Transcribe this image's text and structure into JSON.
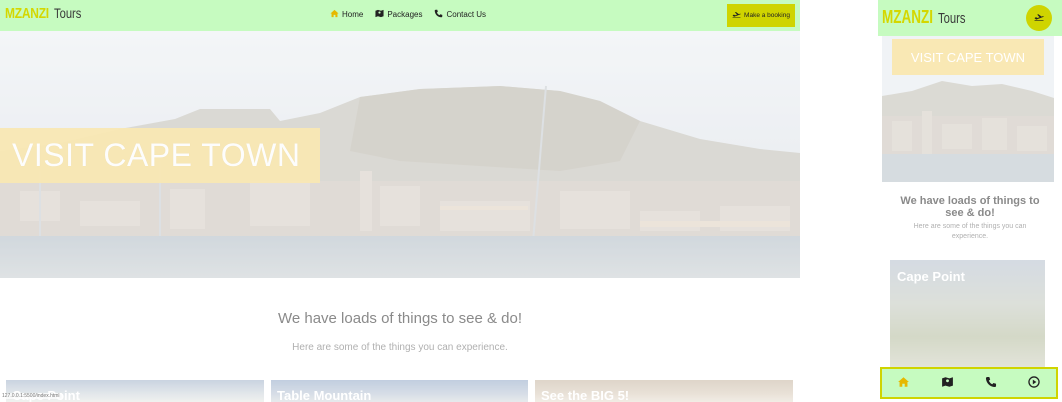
{
  "desktop": {
    "brand": {
      "main": "MZANZI",
      "sub": "Tours"
    },
    "nav": [
      {
        "label": "Home",
        "icon": "home-icon"
      },
      {
        "label": "Packages",
        "icon": "map-icon"
      },
      {
        "label": "Contact Us",
        "icon": "phone-icon"
      }
    ],
    "book_button": {
      "label": "Make a booking",
      "icon": "plane-icon"
    },
    "hero": {
      "title": "VISIT CAPE TOWN"
    },
    "section": {
      "heading": "We have loads of things to see & do!",
      "subheading": "Here are some of the things you can experience."
    },
    "cards": [
      {
        "title": "Cape Point"
      },
      {
        "title": "Table Mountain"
      },
      {
        "title": "See the BIG 5!"
      }
    ],
    "status_url": "127.0.0.1:5500/index.html"
  },
  "mobile": {
    "brand": {
      "main": "MZANZI",
      "sub": "Tours"
    },
    "book_icon": "plane-icon",
    "hero": {
      "title": "VISIT CAPE TOWN"
    },
    "section": {
      "heading": "We have loads of things to see & do!",
      "subheading": "Here are some of the things you can experience."
    },
    "card": {
      "title": "Cape Point"
    },
    "tabbar": [
      {
        "icon": "home-icon"
      },
      {
        "icon": "map-icon"
      },
      {
        "icon": "phone-icon"
      },
      {
        "icon": "play-circle-icon"
      }
    ]
  },
  "colors": {
    "nav_bg": "#c6fbc0",
    "accent": "#cfd400",
    "brand_yellow": "#d4d700",
    "hero_title_box": "#f9e8b4",
    "home_icon": "#e6b800"
  }
}
